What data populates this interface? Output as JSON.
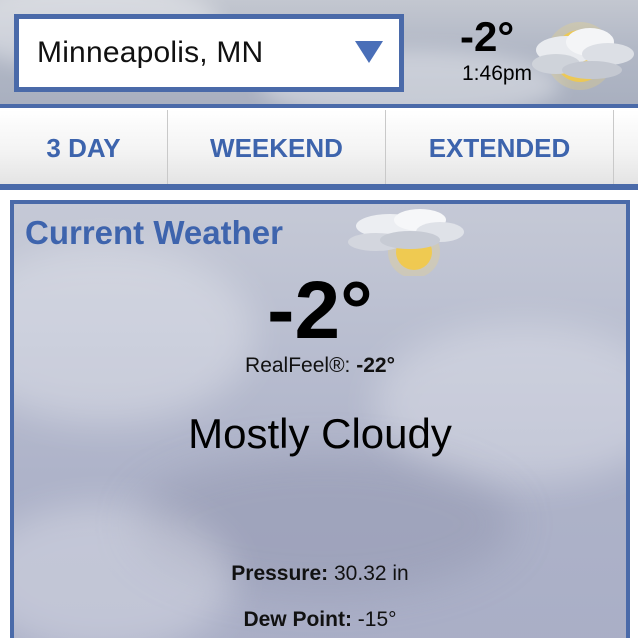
{
  "header": {
    "location": "Minneapolis, MN",
    "temperature": "-2°",
    "time": "1:46pm",
    "icon": "mostly-cloudy-icon"
  },
  "tabs": [
    {
      "label": "3 DAY"
    },
    {
      "label": "WEEKEND"
    },
    {
      "label": "EXTENDED"
    }
  ],
  "current": {
    "title": "Current Weather",
    "temperature": "-2°",
    "realfeel_label": "RealFeel®:",
    "realfeel_value": "-22°",
    "condition": "Mostly Cloudy",
    "icon": "mostly-cloudy-icon",
    "pressure_label": "Pressure:",
    "pressure_value": "30.32 in",
    "dewpoint_label": "Dew Point:",
    "dewpoint_value": "-15°"
  },
  "colors": {
    "accent": "#4a6aa9",
    "tab_text": "#3d64ad",
    "title_text": "#3e64ad"
  }
}
